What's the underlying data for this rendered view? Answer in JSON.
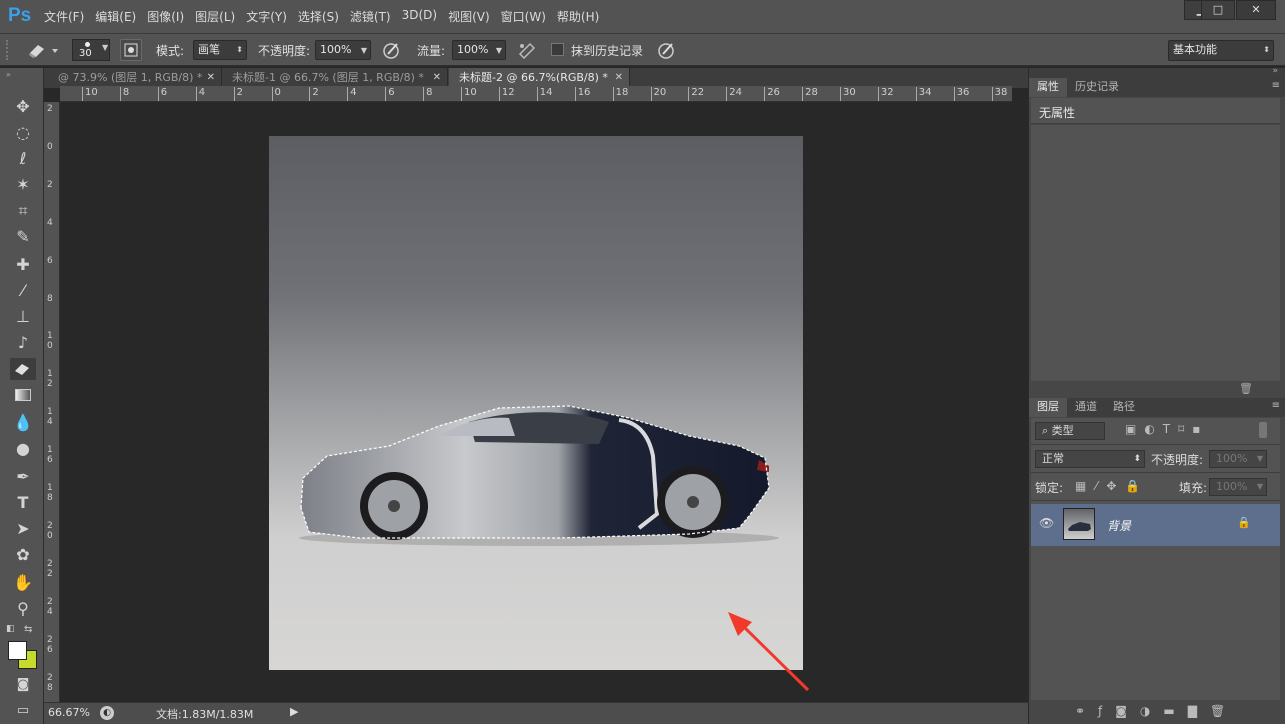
{
  "app": {
    "logo": "Ps"
  },
  "menu": [
    "文件(F)",
    "编辑(E)",
    "图像(I)",
    "图层(L)",
    "文字(Y)",
    "选择(S)",
    "滤镜(T)",
    "3D(D)",
    "视图(V)",
    "窗口(W)",
    "帮助(H)"
  ],
  "window_controls": {
    "minimize": "▁",
    "maximize": "□",
    "close": "✕"
  },
  "options": {
    "brush_size": "30",
    "mode_label": "模式:",
    "mode_value": "画笔",
    "opacity_label": "不透明度:",
    "opacity_value": "100%",
    "flow_label": "流量:",
    "flow_value": "100%",
    "erase_history_label": "抹到历史记录",
    "workspace": "基本功能"
  },
  "tabs": [
    {
      "label": "@ 73.9% (图层 1, RGB/8) *"
    },
    {
      "label": "未标题-1 @ 66.7% (图层 1, RGB/8) *"
    },
    {
      "label": "未标题-2 @ 66.7%(RGB/8) *"
    }
  ],
  "ruler_top_ticks": [
    "10",
    "8",
    "6",
    "4",
    "2",
    "0",
    "2",
    "4",
    "6",
    "8",
    "10",
    "12",
    "14",
    "16",
    "18",
    "20",
    "22",
    "24",
    "26",
    "28",
    "30",
    "32",
    "34",
    "36",
    "38"
  ],
  "ruler_left_ticks": [
    "2",
    "0",
    "2",
    "4",
    "6",
    "8",
    "1 0",
    "1 2",
    "1 4",
    "1 6",
    "1 8",
    "2 0",
    "2 2",
    "2 4",
    "2 6",
    "2 8"
  ],
  "status": {
    "zoom": "66.67%",
    "doc": "文档:1.83M/1.83M"
  },
  "properties_panel": {
    "tabs": [
      "属性",
      "历史记录"
    ],
    "content": "无属性"
  },
  "layers_panel": {
    "tabs": [
      "图层",
      "通道",
      "路径"
    ],
    "filter_type": "类型",
    "blend_mode": "正常",
    "opacity_label": "不透明度:",
    "opacity_value": "100%",
    "lock_label": "锁定:",
    "fill_label": "填充:",
    "fill_value": "100%",
    "layers": [
      {
        "name": "背景",
        "locked": true,
        "visible": true
      }
    ]
  },
  "colors": {
    "accent": "#3aa0e8",
    "layer_selected": "#5d6f8c",
    "background_swatch": "#c6dc2c",
    "foreground_swatch": "#ffffff"
  }
}
